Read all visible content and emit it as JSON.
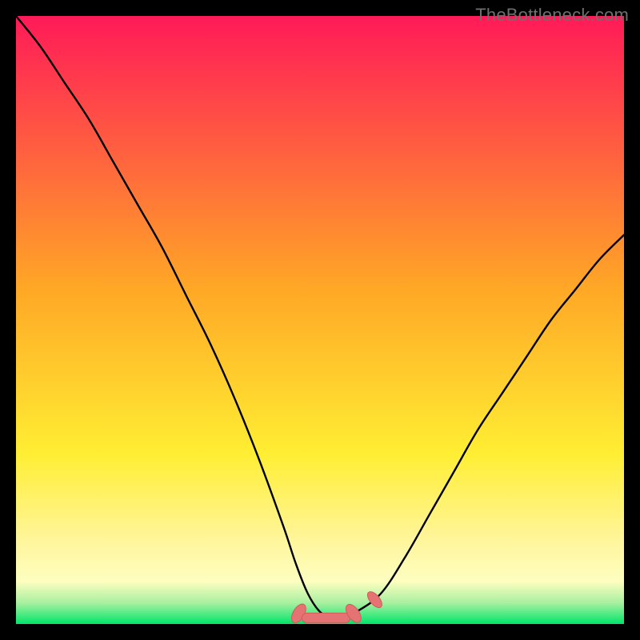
{
  "watermark": {
    "text": "TheBottleneck.com"
  },
  "colors": {
    "black": "#000000",
    "curve": "#000000",
    "markerFill": "#e57373",
    "markerStroke": "#d45b5b",
    "watermark": "#6f6f6f",
    "gradientStops": [
      {
        "offset": 0.0,
        "color": "#ff1a58"
      },
      {
        "offset": 0.45,
        "color": "#ffa826"
      },
      {
        "offset": 0.72,
        "color": "#ffee33"
      },
      {
        "offset": 0.86,
        "color": "#fff59a"
      },
      {
        "offset": 0.93,
        "color": "#fdfec0"
      },
      {
        "offset": 0.965,
        "color": "#a9f0a0"
      },
      {
        "offset": 1.0,
        "color": "#00e56a"
      }
    ]
  },
  "chart_data": {
    "type": "line",
    "title": "",
    "xlabel": "",
    "ylabel": "",
    "xlim": [
      0,
      100
    ],
    "ylim": [
      0,
      100
    ],
    "grid": false,
    "legend": false,
    "series": [
      {
        "name": "bottleneck-curve",
        "x": [
          0,
          4,
          8,
          12,
          16,
          20,
          24,
          28,
          32,
          36,
          40,
          44,
          46,
          48,
          50,
          52,
          54,
          56,
          60,
          64,
          68,
          72,
          76,
          80,
          84,
          88,
          92,
          96,
          100
        ],
        "y": [
          100,
          95,
          89,
          83,
          76,
          69,
          62,
          54,
          46,
          37,
          27,
          16,
          10,
          5,
          2,
          1,
          1,
          2,
          5,
          11,
          18,
          25,
          32,
          38,
          44,
          50,
          55,
          60,
          64
        ]
      }
    ],
    "markers": [
      {
        "name": "flat-start",
        "x": 46.5,
        "y": 2
      },
      {
        "name": "flat-end",
        "x": 55.5,
        "y": 2
      },
      {
        "name": "right-bump",
        "x": 59.0,
        "y": 4
      }
    ],
    "background_gradient_axis": "y"
  }
}
